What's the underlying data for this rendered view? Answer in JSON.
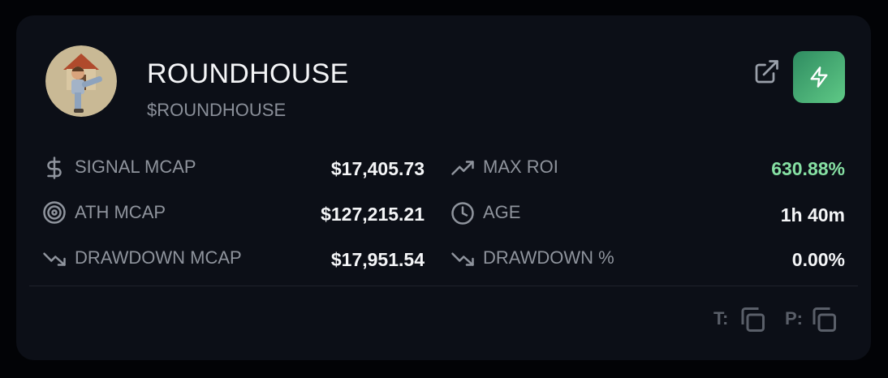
{
  "token": {
    "name": "ROUNDHOUSE",
    "ticker": "$ROUNDHOUSE"
  },
  "header": {
    "external_link_icon": "external-link-icon",
    "action_icon": "lightning-bolt-icon",
    "action_color": "#4fb47a"
  },
  "stats": {
    "signal_mcap": {
      "label": "SIGNAL MCAP",
      "value": "$17,405.73",
      "icon": "dollar-icon"
    },
    "ath_mcap": {
      "label": "ATH MCAP",
      "value": "$127,215.21",
      "icon": "target-icon"
    },
    "drawdown_mcap": {
      "label": "DRAWDOWN MCAP",
      "value": "$17,951.54",
      "icon": "trend-down-icon"
    },
    "max_roi": {
      "label": "MAX ROI",
      "value": "630.88%",
      "icon": "trend-up-icon",
      "color": "#86e0a3"
    },
    "age": {
      "label": "AGE",
      "value": "1h 40m",
      "icon": "clock-icon"
    },
    "drawdown_pct": {
      "label": "DRAWDOWN %",
      "value": "0.00%",
      "icon": "trend-down-icon"
    }
  },
  "footer": {
    "token_copy_label": "T:",
    "pair_copy_label": "P:",
    "copy_icon": "copy-icon"
  }
}
